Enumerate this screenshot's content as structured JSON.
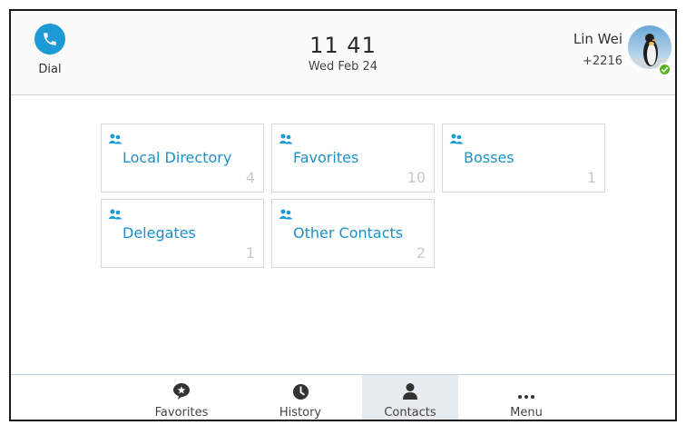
{
  "header": {
    "dial_label": "Dial",
    "time": "11 41",
    "date": "Wed Feb 24",
    "user_name": "Lin Wei",
    "user_extension": "+2216",
    "presence_status": "available"
  },
  "directories": [
    {
      "label": "Local Directory",
      "count": "4",
      "icon": "contacts-group-icon"
    },
    {
      "label": "Favorites",
      "count": "10",
      "icon": "contacts-group-icon"
    },
    {
      "label": "Bosses",
      "count": "1",
      "icon": "contacts-group-icon"
    },
    {
      "label": "Delegates",
      "count": "1",
      "icon": "contacts-group-icon"
    },
    {
      "label": "Other Contacts",
      "count": "2",
      "icon": "contacts-group-icon"
    }
  ],
  "nav": {
    "items": [
      {
        "label": "Favorites",
        "icon": "star-bubble-icon"
      },
      {
        "label": "History",
        "icon": "clock-icon"
      },
      {
        "label": "Contacts",
        "icon": "person-icon"
      },
      {
        "label": "Menu",
        "icon": "more-icon"
      }
    ],
    "active": "Contacts"
  },
  "colors": {
    "accent": "#1c9ad6",
    "tile_label": "#1d8fc9",
    "count_text": "#c9c9c9",
    "presence": "#5bb324",
    "active_tab": "#e6ebef"
  }
}
